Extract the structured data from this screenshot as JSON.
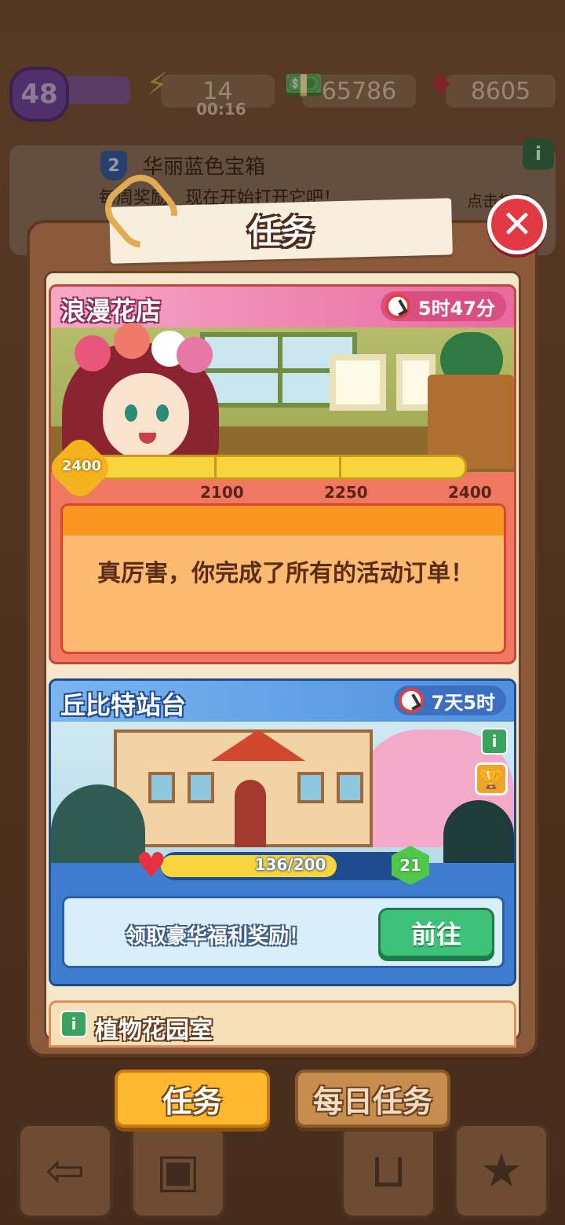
{
  "hud": {
    "level": "48",
    "energy": "14",
    "energy_timer": "00:16",
    "cash": "65786",
    "gems": "8605"
  },
  "notice": {
    "badge_level": "2",
    "title": "华丽蓝色宝箱",
    "text": "每周奖励。现在开始打开它吧！",
    "hint": "点击打开",
    "info": "i"
  },
  "modal": {
    "title": "任务",
    "close_icon": "close-icon"
  },
  "event_flower_shop": {
    "title": "浪漫花店",
    "time_left": "5时47分",
    "current_points": "2400",
    "progress": 1.0,
    "milestones": [
      "2100",
      "2250",
      "2400"
    ],
    "message": "真厉害，你完成了所有的活动订单！"
  },
  "event_cupid": {
    "title": "丘比特站台",
    "time_left": "7天5时",
    "info": "i",
    "hearts_text": "136/200",
    "hearts_fraction": 0.68,
    "level": "21",
    "reward_text": "领取豪华福利奖励！",
    "go_label": "前往"
  },
  "event_garden": {
    "title": "植物花园室",
    "info": "i"
  },
  "tabs": {
    "tasks": "任务",
    "daily": "每日任务"
  },
  "colors": {
    "accent_pink": "#e86aa0",
    "accent_blue": "#3e7cd0",
    "go_green": "#3ec27a",
    "close_red": "#e23a45",
    "tab_active": "#ffb830"
  }
}
